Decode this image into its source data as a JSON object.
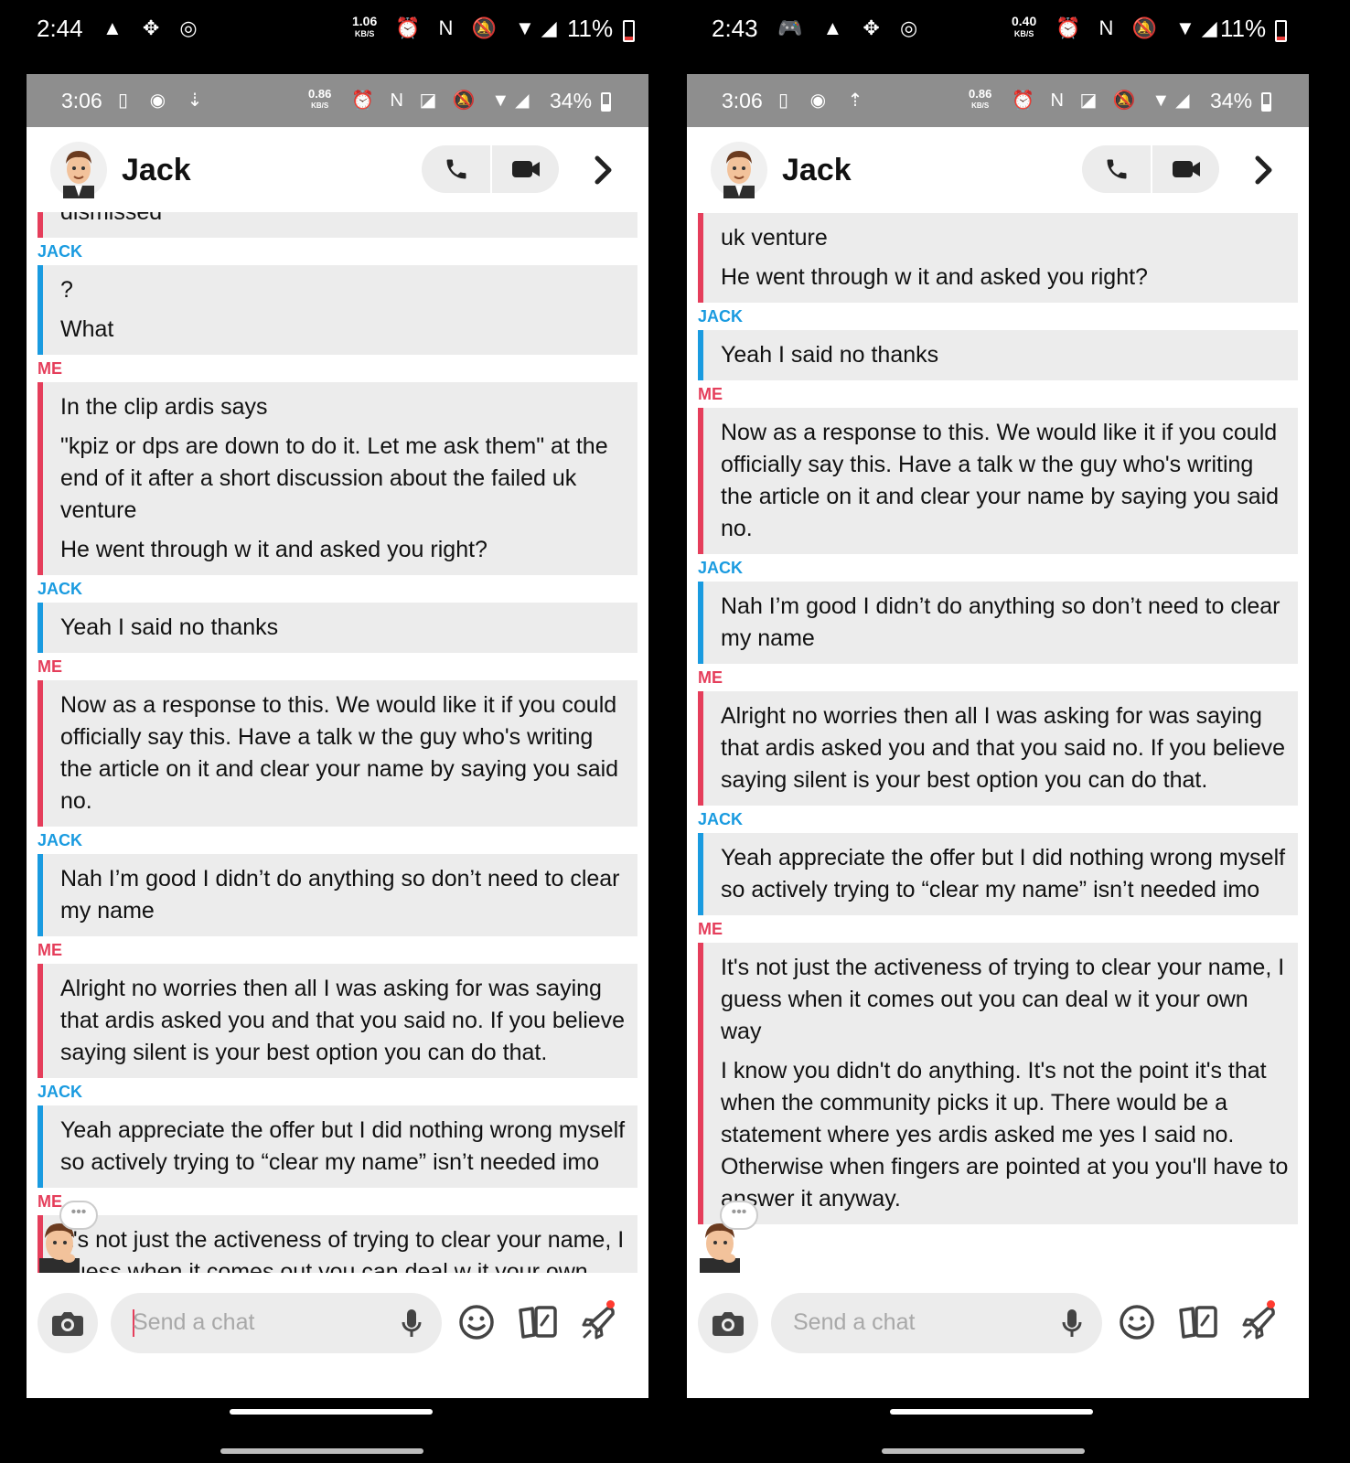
{
  "phones": [
    {
      "outer_status": {
        "time": "2:44",
        "left_icons": "▲ ✥ ◎",
        "speed_value": "1.06",
        "speed_unit": "KB/S",
        "right_icons": "⏰ N 🔕 ▼◢",
        "battery": "11%"
      },
      "inner_status": {
        "time": "3:06",
        "left_icons": "▯ ◉ ⇣",
        "speed_value": "0.86",
        "speed_unit": "KB/S",
        "right_icons": "⏰ N ◪ 🔕 ▼◢",
        "battery": "34%"
      },
      "contact_name": "Jack",
      "messages": [
        {
          "sender": "ME",
          "lines": [
            "dismissed"
          ]
        },
        {
          "sender": "JACK",
          "lines": [
            "?",
            "What"
          ]
        },
        {
          "sender": "ME",
          "lines": [
            "In the clip ardis says",
            "\"kpiz or dps are down to do it. Let me ask them\" at the end of it after a short discussion about the failed uk venture",
            "He went through w it and asked you right?"
          ]
        },
        {
          "sender": "JACK",
          "lines": [
            "Yeah I said no thanks"
          ]
        },
        {
          "sender": "ME",
          "lines": [
            "Now as a response to this. We would like it if you could officially say this. Have a talk w the guy who's writing the article on it and clear your name by saying you said no."
          ]
        },
        {
          "sender": "JACK",
          "lines": [
            "Nah I’m good I didn’t do anything so don’t need to clear my name"
          ]
        },
        {
          "sender": "ME",
          "lines": [
            "Alright no worries then all I was asking for was saying that ardis asked you and that you said no. If you believe saying silent is your best option you can do that."
          ]
        },
        {
          "sender": "JACK",
          "lines": [
            "Yeah appreciate the offer but I did nothing wrong myself so actively trying to “clear my name” isn’t needed imo"
          ]
        },
        {
          "sender": "ME",
          "lines": [
            "It's not just the activeness of trying to clear your name, I guess when it comes out you can deal w it your own way"
          ]
        }
      ],
      "input_placeholder": "Send a chat"
    },
    {
      "outer_status": {
        "time": "2:43",
        "left_icons": "🎮 ▲ ✥ ◎",
        "speed_value": "0.40",
        "speed_unit": "KB/S",
        "right_icons": "⏰ N 🔕 ▼◢",
        "battery": "11%"
      },
      "inner_status": {
        "time": "3:06",
        "left_icons": "▯ ◉ ⇡",
        "speed_value": "0.86",
        "speed_unit": "KB/S",
        "right_icons": "⏰ N ◪ 🔕 ▼◢",
        "battery": "34%"
      },
      "contact_name": "Jack",
      "messages": [
        {
          "sender": "ME",
          "lines": [
            "uk venture",
            "He went through w it and asked you right?"
          ]
        },
        {
          "sender": "JACK",
          "lines": [
            "Yeah I said no thanks"
          ]
        },
        {
          "sender": "ME",
          "lines": [
            "Now as a response to this. We would like it if you could officially say this. Have a talk w the guy who's writing the article on it and clear your name by saying you said no."
          ]
        },
        {
          "sender": "JACK",
          "lines": [
            "Nah I’m good I didn’t do anything so don’t need to clear my name"
          ]
        },
        {
          "sender": "ME",
          "lines": [
            "Alright no worries then all I was asking for was saying that ardis asked you and that you said no. If you believe saying silent is your best option you can do that."
          ]
        },
        {
          "sender": "JACK",
          "lines": [
            "Yeah appreciate the offer but I did nothing wrong myself so actively trying to “clear my name” isn’t needed imo"
          ]
        },
        {
          "sender": "ME",
          "lines": [
            "It's not just the activeness of trying to clear your name, I guess when it comes out you can deal w it your own way",
            "I know you didn't do anything. It's not the point it's that when the community picks it up. There would be a statement where yes ardis asked me yes I said no. Otherwise when fingers are pointed at you you'll have to answer it anyway."
          ]
        }
      ],
      "input_placeholder": "Send a chat"
    }
  ],
  "colors": {
    "me": "#e53e5b",
    "jack": "#1a9be0",
    "bubble_bg": "#ececec",
    "inner_status_bg": "#8e8e8e"
  },
  "icons": [
    "phone-icon",
    "video-icon",
    "chevron-right-icon",
    "camera-icon",
    "mic-icon",
    "smiley-icon",
    "cards-icon",
    "rocket-icon",
    "typing-indicator-icon"
  ]
}
